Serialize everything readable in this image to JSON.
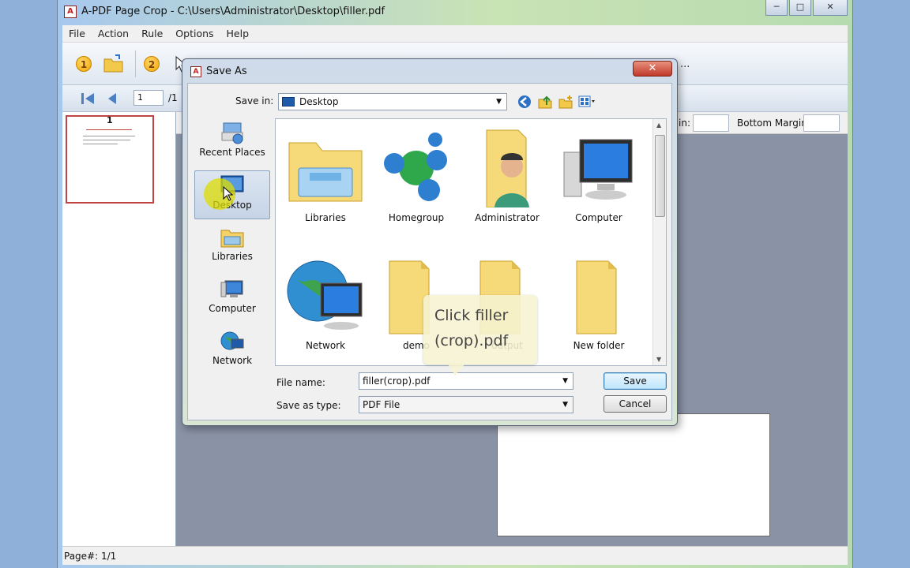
{
  "app": {
    "title": "A-PDF Page Crop - C:\\Users\\Administrator\\Desktop\\filler.pdf",
    "icon": "pdf-app-icon",
    "window_buttons": {
      "minimize": "─",
      "maximize": "□",
      "close": "✕"
    }
  },
  "menu": [
    "File",
    "Action",
    "Rule",
    "Options",
    "Help"
  ],
  "toolbar": {
    "step1": "1",
    "step2": "2",
    "more": "..."
  },
  "nav": {
    "page_value": "1",
    "page_total": "/1"
  },
  "thumbnail": {
    "page_number": "1"
  },
  "margins": {
    "left_label_partial": "in:",
    "bottom_label": "Bottom Margin:"
  },
  "status": {
    "page": "Page#: 1/1"
  },
  "dialog": {
    "title": "Save As",
    "close": "✕",
    "save_in_label": "Save in:",
    "save_in_value": "Desktop",
    "places": [
      "Recent Places",
      "Desktop",
      "Libraries",
      "Computer",
      "Network"
    ],
    "active_place": "Desktop",
    "items": [
      {
        "label": "Libraries",
        "icon": "libraries-folder-icon"
      },
      {
        "label": "Homegroup",
        "icon": "homegroup-icon"
      },
      {
        "label": "Administrator",
        "icon": "user-folder-icon"
      },
      {
        "label": "Computer",
        "icon": "computer-icon"
      },
      {
        "label": "Network",
        "icon": "network-globe-icon"
      },
      {
        "label": "demo",
        "icon": "folder-icon"
      },
      {
        "label": "output",
        "icon": "folder-icon"
      },
      {
        "label": "New folder",
        "icon": "folder-icon"
      }
    ],
    "file_name_label": "File name:",
    "file_name_value": "filler(crop).pdf",
    "save_type_label": "Save as type:",
    "save_type_value": "PDF File",
    "save_button": "Save",
    "cancel_button": "Cancel"
  },
  "callout": {
    "line1": "Click filler",
    "line2": "(crop).pdf"
  },
  "colors": {
    "accent": "#3c7fb1",
    "workspace": "#8a93a6",
    "dialog_close": "#c0392b",
    "highlight": "#dcdc00"
  }
}
